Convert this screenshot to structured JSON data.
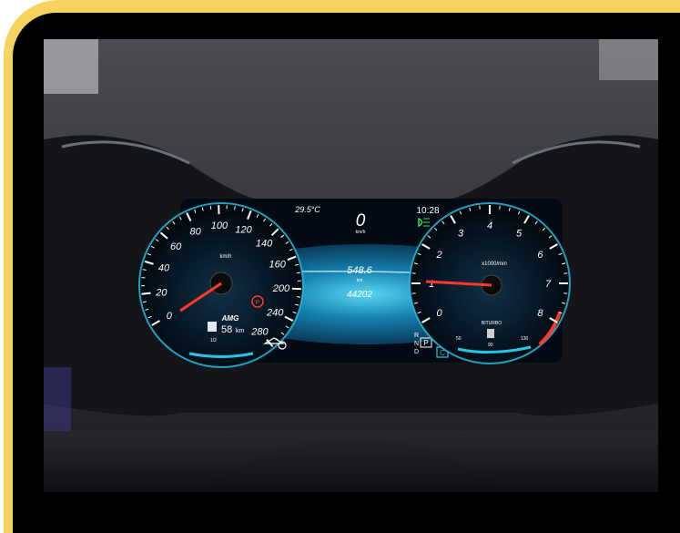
{
  "cluster": {
    "outside_temp": "29.5°C",
    "clock": "10:28",
    "digital_speed": "0",
    "digital_speed_unit": "km/h",
    "trip_distance": "548.6",
    "trip_unit": "km",
    "odometer": "44202",
    "gear_options": [
      "R",
      "N",
      "P",
      "D"
    ],
    "selected_gear": "P",
    "drive_mode": "C"
  },
  "speedometer": {
    "unit_label": "km/h",
    "brand_badge": "AMG",
    "tick_labels": [
      "0",
      "20",
      "40",
      "60",
      "80",
      "100",
      "120",
      "140",
      "160",
      "200",
      "240",
      "280"
    ],
    "needle_value": 0,
    "range_text": "58",
    "range_unit": "km",
    "fuel_half_label": "1/2"
  },
  "tachometer": {
    "unit_label": "x1000/min",
    "tick_labels": [
      "0",
      "1",
      "2",
      "3",
      "4",
      "5",
      "6",
      "7",
      "8"
    ],
    "needle_value": 1,
    "biturbo_label": "BITURBO",
    "temp_low": "50",
    "temp_mid": "90",
    "temp_high": "130"
  },
  "colors": {
    "accent_cyan": "#27c6e8",
    "needle_red": "#ff3a28",
    "frame_yellow": "#f6d35f",
    "indicator_green": "#2de05a"
  }
}
